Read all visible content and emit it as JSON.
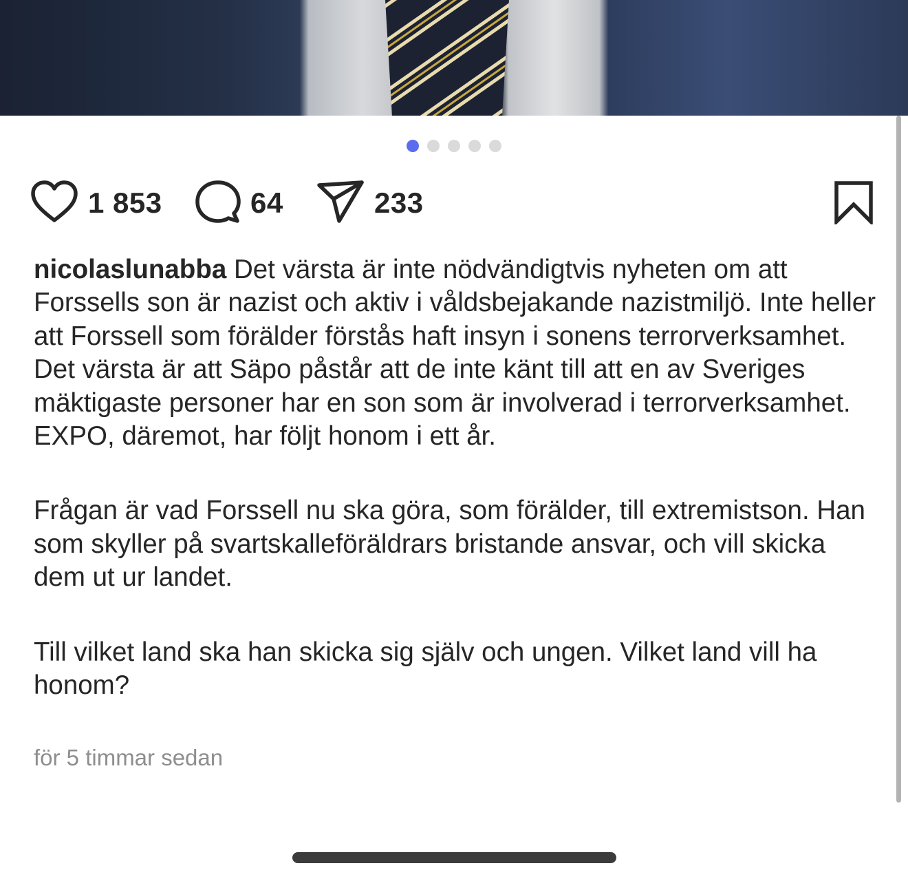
{
  "post": {
    "carousel": {
      "pages": 5,
      "current_index": 0,
      "active_color": "#5b6cf0",
      "inactive_color": "#dadada"
    },
    "actions": {
      "likes": "1 853",
      "comments": "64",
      "shares": "233"
    },
    "icons": [
      "heart-icon",
      "comment-icon",
      "share-icon",
      "bookmark-icon"
    ],
    "caption": {
      "username": "nicolaslunabba",
      "paragraph_1": "Det värsta är inte nödvändigtvis nyheten om att Forssells son är nazist och aktiv i våldsbejakande nazistmiljö. Inte heller att Forssell som förälder förstås haft insyn i sonens terrorverksamhet. Det värsta är att Säpo påstår att de inte känt till att en av Sveriges mäktigaste personer har en son som är involverad i terrorverksamhet. EXPO, däremot, har följt honom i ett år.",
      "paragraph_2": "Frågan är vad Forssell nu ska göra, som förälder, till extremistson. Han som skyller på svartskalleföräldrars bristande ansvar, och vill skicka dem ut ur landet.",
      "paragraph_3": "Till vilket land ska han skicka sig själv och ungen. Vilket land vill ha honom?"
    },
    "timestamp": "för 5 timmar sedan"
  }
}
